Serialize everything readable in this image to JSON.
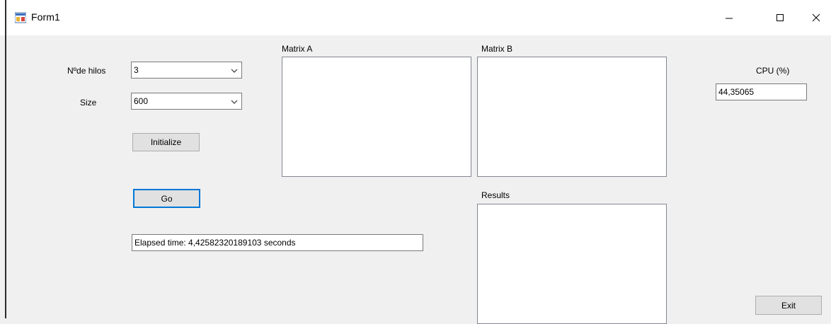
{
  "window": {
    "title": "Form1",
    "icon": "winforms-app-icon",
    "controls": [
      "minimize-icon",
      "maximize-icon",
      "close-icon"
    ]
  },
  "form": {
    "threads_label": "Nºde hilos",
    "threads_value": "3",
    "size_label": "Size",
    "size_value": "600",
    "initialize_button": "Initialize",
    "go_button": "Go",
    "elapsed_text": "Elapsed time: 4,42582320189103 seconds",
    "matrix_a_label": "Matrix A",
    "matrix_b_label": "Matrix B",
    "results_label": "Results",
    "cpu_label": "CPU (%)",
    "cpu_value": "44,35065",
    "exit_button": "Exit"
  },
  "colors": {
    "focus_border": "#0078d7",
    "form_background": "#f0f0f0",
    "button_face": "#e1e1e1"
  }
}
